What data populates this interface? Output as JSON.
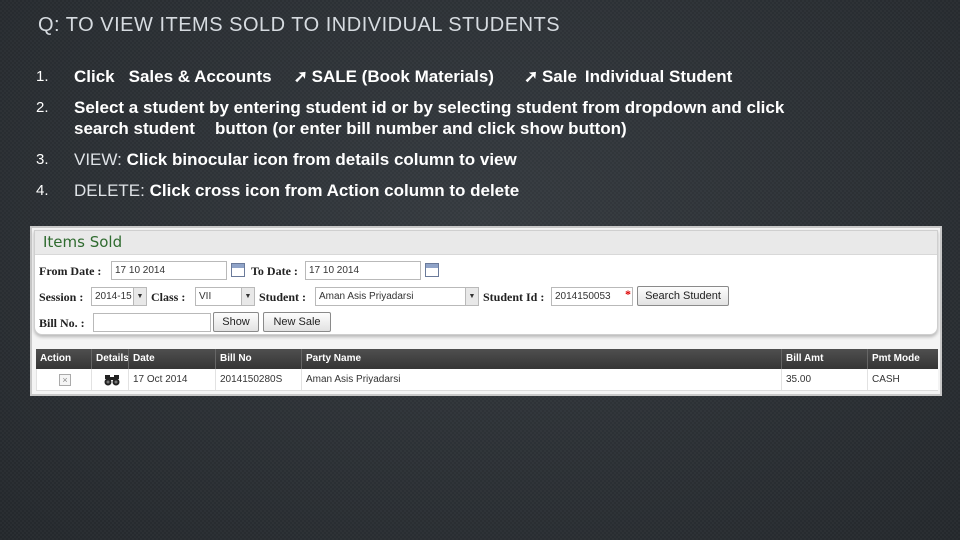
{
  "slide": {
    "title": "Q: TO VIEW ITEMS SOLD TO INDIVIDUAL STUDENTS",
    "steps": [
      {
        "num": "1.",
        "parts": [
          "Click",
          "Sales & Accounts",
          "SALE (Book Materials)",
          "Sale",
          "Individual Student"
        ]
      },
      {
        "num": "2.",
        "line1": "Select a student by entering student id or by selecting student from dropdown and click",
        "line2a": "search student",
        "line2b": "button (or enter bill number and click show button)"
      },
      {
        "num": "3.",
        "label": "VIEW:",
        "text": "Click binocular icon from details column to view"
      },
      {
        "num": "4.",
        "label": "DELETE:",
        "text": "Click cross icon from  Action column to delete"
      }
    ]
  },
  "form": {
    "title": "Items Sold",
    "from_date_label": "From Date :",
    "from_date_value": "17 10 2014",
    "to_date_label": "To Date :",
    "to_date_value": "17 10 2014",
    "session_label": "Session :",
    "session_value": "2014-15",
    "class_label": "Class :",
    "class_value": "VII",
    "student_label": "Student :",
    "student_value": "Aman Asis Priyadarsi",
    "student_id_label": "Student Id :",
    "student_id_value": "2014150053",
    "required_mark": "*",
    "search_button": "Search Student",
    "bill_no_label": "Bill No. :",
    "bill_no_value": "",
    "show_button": "Show",
    "new_sale_button": "New Sale"
  },
  "grid": {
    "columns": [
      "Action",
      "Details",
      "Date",
      "Bill No",
      "Party Name",
      "Bill Amt",
      "Pmt Mode"
    ],
    "rows": [
      {
        "action": "×",
        "date": "17 Oct 2014",
        "bill_no": "2014150280S",
        "party": "Aman Asis Priyadarsi",
        "amount": "35.00",
        "mode": "CASH"
      }
    ]
  },
  "colors": {
    "header_bar": "#3f3f3f",
    "title_green": "#2f6b2f",
    "slide_bg": "#2b2f33"
  },
  "icons": {
    "calendar": "calendar-icon",
    "binocular": "binocular-icon",
    "delete": "cross-icon",
    "dropdown": "chevron-down-icon"
  }
}
